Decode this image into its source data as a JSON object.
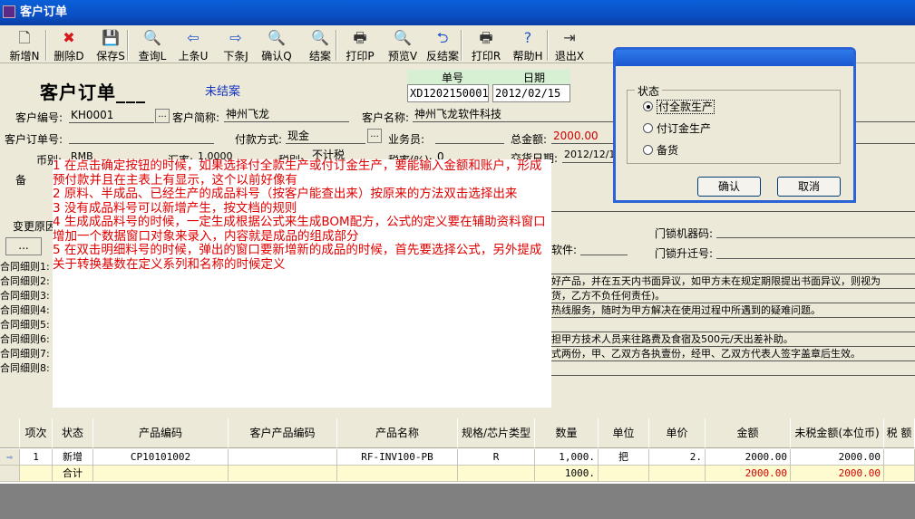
{
  "window": {
    "title": "客户订单"
  },
  "toolbar": [
    {
      "id": "new",
      "label": "新增N",
      "icon": "new-document-icon",
      "glyph": "🗋"
    },
    {
      "id": "delete",
      "label": "删除D",
      "icon": "delete-x-icon",
      "glyph": "✖"
    },
    {
      "id": "save",
      "label": "保存S",
      "icon": "floppy-disk-icon",
      "glyph": "💾"
    },
    {
      "id": "query",
      "label": "查询L",
      "icon": "magnifier-document-icon",
      "glyph": "🔍"
    },
    {
      "id": "prev",
      "label": "上条U",
      "icon": "arrow-left-icon",
      "glyph": "⇦"
    },
    {
      "id": "next",
      "label": "下条J",
      "icon": "arrow-right-icon",
      "glyph": "⇨"
    },
    {
      "id": "confirm",
      "label": "确认Q",
      "icon": "magnifier-icon",
      "glyph": "🔍"
    },
    {
      "id": "close",
      "label": "结案",
      "icon": "magnifier-icon",
      "glyph": "🔍"
    },
    {
      "id": "print",
      "label": "打印P",
      "icon": "printer-icon",
      "glyph": "🖶"
    },
    {
      "id": "preview",
      "label": "预览V",
      "icon": "magnifier-icon",
      "glyph": "🔍"
    },
    {
      "id": "reopen",
      "label": "反结案",
      "icon": "return-arrow-icon",
      "glyph": "⮌"
    },
    {
      "id": "printr",
      "label": "打印R",
      "icon": "printer-person-icon",
      "glyph": "🖶"
    },
    {
      "id": "help",
      "label": "帮助H",
      "icon": "help-question-icon",
      "glyph": "?"
    },
    {
      "id": "exit",
      "label": "退出X",
      "icon": "exit-door-icon",
      "glyph": "⇥"
    }
  ],
  "header": {
    "title": "客户订单___",
    "status": "未结案",
    "order_no_label": "单号",
    "order_no": "XD1202150001",
    "date_label": "日期",
    "date": "2012/02/15"
  },
  "form": {
    "customer_code_label": "客户编号:",
    "customer_code": "KH0001",
    "customer_short_label": "客户简称:",
    "customer_short": "神州飞龙",
    "customer_name_label": "客户名称:",
    "customer_name": "神州飞龙软件科技",
    "cust_order_label": "客户订单号:",
    "cust_order": "",
    "payment_label": "付款方式:",
    "payment": "现金",
    "salesman_label": "业务员:",
    "salesman": "",
    "total_label": "总金额:",
    "total": "2000.00",
    "currency_label": "币别:",
    "currency": "RMB",
    "rate_label": "汇率:",
    "rate": "1.0000",
    "tax_label": "税别:",
    "tax": "不计税",
    "taxrate_label": "税率(%):",
    "taxrate": "0",
    "delivery_label": "交货日期:",
    "delivery": "2012/12/1",
    "remark_label": "备",
    "change_label": "变更原因:",
    "software_label": "软件:",
    "lock_machine_label": "门锁机器码:",
    "lock_upgrade_label": "门锁升迁号:",
    "dots_button": "..."
  },
  "contract": {
    "labels": [
      "合同细则1:",
      "合同细则2:",
      "合同细则3:",
      "合同细则4:",
      "合同细则5:",
      "合同细则6:",
      "合同细则7:",
      "合同细则8:"
    ],
    "texts": [
      "",
      "好产品，并在五天内书面异议，如甲方未在规定期限提出书面异议，则视为",
      "货，乙方不负任何责任)。",
      "热线服务，随时为甲方解决在使用过程中所遇到的疑难问题。",
      "",
      "担甲方技术人员来往路费及食宿及500元/天出差补助。",
      "式两份，甲、乙双方各执壹份，经甲、乙双方代表人签字盖章后生效。",
      ""
    ]
  },
  "notes": [
    "1 在点击确定按钮的时候，如果选择付全款生产或付订金生产，要能输入金额和账户，形成预付款并且在主表上有显示，这个以前好像有",
    "2 原料、半成品、已经生产的成品料号（按客户能查出来）按原来的方法双击选择出来",
    "3 没有成品料号可以新增产生，按文档的规则",
    "4 生成成品料号的时候，一定生成根据公式来生成BOM配方，公式的定义要在辅助资料窗口增加一个数据窗口对象来录入，内容就是成品的组成部分",
    "5 在双击明细料号的时候，弹出的窗口要新增新的成品的时候，首先要选择公式，另外提成关于转换基数在定义系列和名称的时候定义"
  ],
  "dialog": {
    "group_label": "状态",
    "options": [
      "付全款生产",
      "付订金生产",
      "备货"
    ],
    "selected": 0,
    "ok": "确认",
    "cancel": "取消"
  },
  "grid": {
    "columns": [
      "项次",
      "状态",
      "产品编码",
      "客户产品编码",
      "产品名称",
      "规格/芯片类型",
      "数量",
      "单位",
      "单价",
      "金额",
      "未税金额(本位币)",
      "税 额"
    ],
    "rows": [
      [
        "1",
        "新增",
        "CP10101002",
        "",
        "RF-INV100-PB",
        "R",
        "1,000.",
        "把",
        "2.",
        "2000.00",
        "2000.00",
        ""
      ]
    ],
    "total_row": [
      "",
      "合计",
      "",
      "",
      "",
      "",
      "1000.",
      "",
      "",
      "2000.00",
      "2000.00",
      ""
    ]
  },
  "colors": {
    "accent": "#0b4fc4",
    "note": "#e00000",
    "total": "#d00000",
    "status": "#1030c0"
  }
}
